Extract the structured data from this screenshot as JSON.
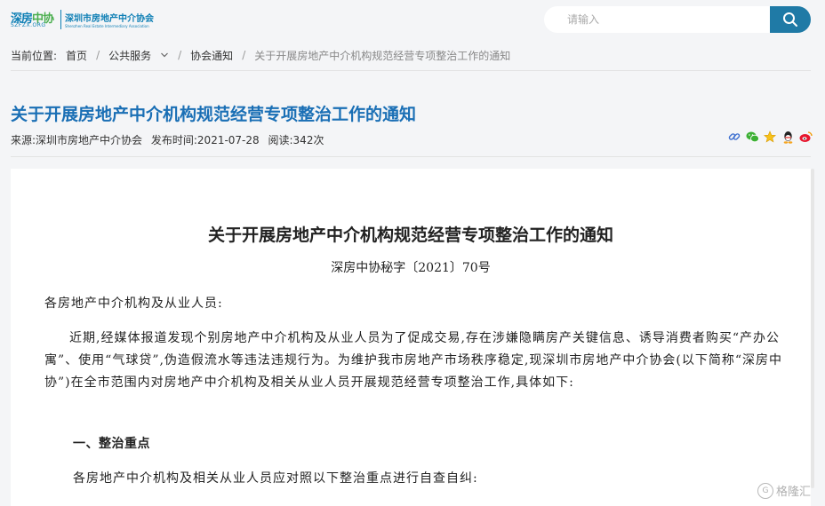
{
  "header": {
    "logo_big_left": "深房",
    "logo_big_right": "中协",
    "logo_small": "SZFZX.ORG",
    "logo_name": "深圳市房地产中介协会",
    "logo_en": "Shenzhen Real Estate Intermediary Association",
    "search_placeholder": "请输入",
    "search_icon": "search-icon"
  },
  "breadcrumb": {
    "prefix": "当前位置:",
    "items": [
      "首页",
      "公共服务",
      "协会通知"
    ],
    "current": "关于开展房地产中介机构规范经营专项整治工作的通知"
  },
  "article": {
    "title": "关于开展房地产中介机构规范经营专项整治工作的通知",
    "source": "来源:深圳市房地产中介协会",
    "published": "发布时间:2021-07-28",
    "reads": "阅读:342次",
    "share_icons": [
      "link-icon",
      "wechat-icon",
      "star-icon",
      "qq-icon",
      "weibo-icon"
    ]
  },
  "document": {
    "title": "关于开展房地产中介机构规范经营专项整治工作的通知",
    "number": "深房中协秘字〔2021〕70号",
    "salutation": "各房地产中介机构及从业人员:",
    "body_paragraph": "近期,经媒体报道发现个别房地产中介机构及从业人员为了促成交易,存在涉嫌隐瞒房产关键信息、诱导消费者购买“产办公寓”、使用“气球贷”,伪造假流水等违法违规行为。为维护我市房地产市场秩序稳定,现深圳市房地产中介协会(以下简称“深房中协”)在全市范围内对房地产中介机构及相关从业人员开展规范经营专项整治工作,具体如下:",
    "section_1": "一、整治重点",
    "paragraph_2": "各房地产中介机构及相关从业人员应对照以下整治重点进行自查自纠:"
  },
  "watermark": {
    "text": "格隆汇",
    "logo_char": "G"
  },
  "colors": {
    "accent": "#1f7aa6",
    "title_blue": "#1a6fb5",
    "background": "#f4f5f7"
  }
}
